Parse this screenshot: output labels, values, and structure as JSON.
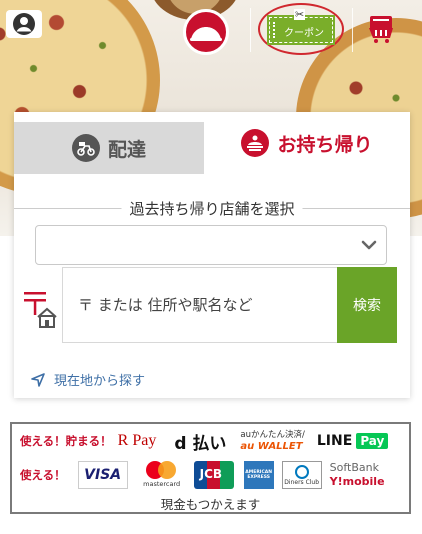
{
  "header": {
    "account_icon": "user-circle-icon",
    "logo_icon": "pizza-hut-logo",
    "coupon_label": "クーポン",
    "cart_icon": "shopping-cart-icon",
    "colors": {
      "brand_red": "#c8102e",
      "coupon_green": "#7aae2a",
      "highlight_ring": "#d0282f"
    }
  },
  "tabs": [
    {
      "label": "配達",
      "icon": "delivery-scooter-icon",
      "active": false
    },
    {
      "label": "お持ち帰り",
      "icon": "takeout-icon",
      "active": true
    }
  ],
  "store_select": {
    "title": "過去持ち帰り店舗を選択",
    "value": ""
  },
  "search": {
    "placeholder": "〒 または 住所や駅名など",
    "button_label": "検索",
    "button_color": "#6aa428"
  },
  "geolocation": {
    "label": "現在地から探す",
    "icon": "location-arrow-icon"
  },
  "payments": {
    "row1": {
      "label": "使える！貯まる！",
      "rpay": "R Pay",
      "dpay": "d 払い",
      "au_top": "auかんたん決済/",
      "au_bottom": "au WALLET",
      "line": "LINE",
      "line_pay": "Pay"
    },
    "row2": {
      "label": "使える！",
      "visa": "VISA",
      "mastercard": "mastercard",
      "jcb": "JCB",
      "amex": "AMERICAN EXPRESS",
      "diners": "Diners Club",
      "softbank": "SoftBank",
      "ymobile": "Y!mobile"
    },
    "footer": "現金もつかえます"
  }
}
